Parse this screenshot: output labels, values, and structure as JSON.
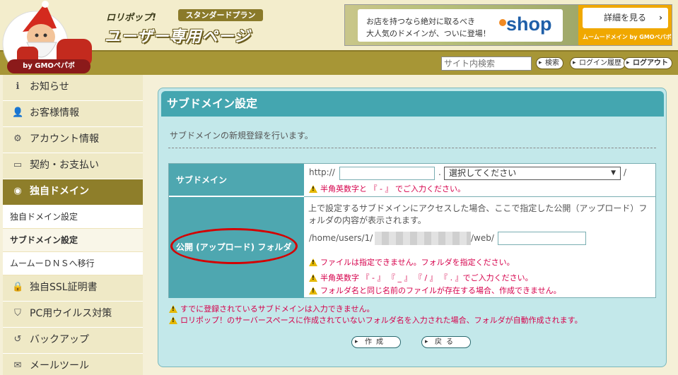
{
  "header": {
    "brand_line": "ロリポップ!",
    "plan": "スタンダードプラン",
    "title": "ユーザー専用ページ",
    "by": "by GMOペパボ"
  },
  "ad": {
    "line1": "お店を持つなら絶対に取るべき",
    "line2": "大人気のドメインが、ついに登場！",
    "logo": "shop",
    "button": "詳細を見る",
    "button_chevron": "›",
    "caption": "ムームードメイン by GMOペパボ"
  },
  "topbar": {
    "search_placeholder": "サイト内検索",
    "search_btn": "検索",
    "history_btn": "ログイン履歴",
    "logout_btn": "ログアウト"
  },
  "sidebar": {
    "items": [
      {
        "label": "お知らせ",
        "icon": "info-icon",
        "glyph": "ℹ"
      },
      {
        "label": "お客様情報",
        "icon": "user-icon",
        "glyph": "👤"
      },
      {
        "label": "アカウント情報",
        "icon": "gear-icon",
        "glyph": "⚙"
      },
      {
        "label": "契約・お支払い",
        "icon": "card-icon",
        "glyph": "▭"
      },
      {
        "label": "独自ドメイン",
        "icon": "globe-icon",
        "glyph": "◉"
      },
      {
        "label": "独自SSL証明書",
        "icon": "lock-icon",
        "glyph": "🔒"
      },
      {
        "label": "PC用ウイルス対策",
        "icon": "shield-icon",
        "glyph": "⛉"
      },
      {
        "label": "バックアップ",
        "icon": "history-icon",
        "glyph": "↺"
      },
      {
        "label": "メールツール",
        "icon": "mail-icon",
        "glyph": "✉"
      }
    ],
    "sub_items": [
      "独自ドメイン設定",
      "サブドメイン設定",
      "ムームーＤＮＳへ移行"
    ]
  },
  "panel": {
    "title": "サブドメイン設定",
    "description": "サブドメインの新規登録を行います。",
    "row1_label": "サブドメイン",
    "row2_label": "公開 (アップロード) フォルダ",
    "http_prefix": "http://",
    "dot": ".",
    "slash": "/",
    "select_value": "選択してください",
    "row1_warn": "半角英数字と 『 - 』 でご入力ください。",
    "row2_info": "上で設定するサブドメインにアクセスした場合、ここで指定した公開（アップロード）フォルダの内容が表示されます。",
    "path_prefix": "/home/users/1/",
    "path_suffix": "/web/",
    "row2_warn1": "ファイルは指定できません。フォルダを指定ください。",
    "row2_warn2": "半角英数字 『 - 』 『 _ 』 『 / 』 『 . 』でご入力ください。",
    "row2_warn3": "フォルダ名と同じ名前のファイルが存在する場合、作成できません。",
    "note1": "すでに登録されているサブドメインは入力できません。",
    "note2": "ロリポップ！のサーバースペースに作成されていないフォルダ名を入力された場合、フォルダが自動作成されます。",
    "create_btn": "作成",
    "back_btn": "戻る"
  },
  "colors": {
    "panel_bg": "#c3e8ea",
    "panel_header": "#44a6b0",
    "sidebar_active": "#8e7e2a",
    "warning_text": "#d6004b",
    "annotation": "#d40000"
  }
}
